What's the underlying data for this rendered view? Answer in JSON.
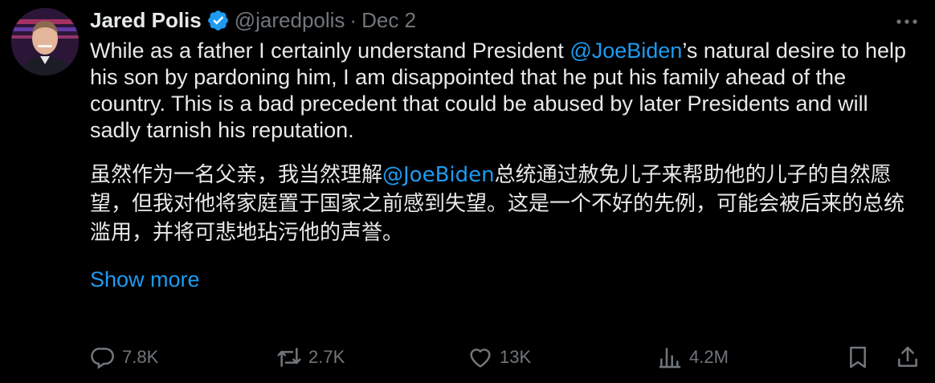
{
  "author": {
    "name": "Jared Polis",
    "handle": "@jaredpolis",
    "separator": "·",
    "date": "Dec 2"
  },
  "tweet": {
    "en_part1": "While as a father I certainly understand President ",
    "en_mention": "@JoeBiden",
    "en_part2": "’s natural desire to help his son by pardoning him, I am disappointed that he put his family ahead of the country. This is a bad precedent that could be abused by later Presidents and will sadly tarnish his reputation.",
    "zh_part1": "虽然作为一名父亲，我当然理解",
    "zh_mention": "@JoeBiden",
    "zh_part2": "总统通过赦免儿子来帮助他的儿子的自然愿望，但我对他将家庭置于国家之前感到失望。这是一个不好的先例，可能会被后来的总统滥用，并将可悲地玷污他的声誉。",
    "show_more": "Show more"
  },
  "actions": {
    "replies": "7.8K",
    "reposts": "2.7K",
    "likes": "13K",
    "views": "4.2M"
  },
  "icons": [
    "verified-badge-icon",
    "more-icon",
    "reply-icon",
    "repost-icon",
    "like-icon",
    "views-icon",
    "bookmark-icon",
    "share-icon"
  ],
  "colors": {
    "background": "#000000",
    "text": "#e7e9ea",
    "muted": "#71767b",
    "accent": "#1d9bf0"
  }
}
